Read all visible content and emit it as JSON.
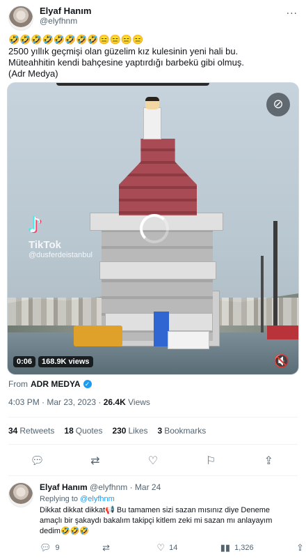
{
  "tweet": {
    "display_name": "Elyaf Hanım",
    "handle": "@elyfhnm",
    "more_icon": "more-icon",
    "emoji_line": "🤣🤣🤣🤣🤣🤣🤣🤣😑😑😑😑",
    "text_line_1": "2500 yıllık geçmişi olan güzelim kız kulesinin yeni hali bu.",
    "text_line_2": "Müteahhitin kendi bahçesine yaptırdığı barbekü gibi olmuş.",
    "text_line_3": "(Adr Medya)"
  },
  "media": {
    "watermark_app": "TikTok",
    "watermark_user": "@dusferdeistanbul",
    "elapsed": "0:06",
    "views": "168.9K views",
    "corner_icon": "media-menu-icon",
    "sound_icon": "mute-icon"
  },
  "source": {
    "prefix": "From",
    "account": "ADR MEDYA"
  },
  "meta": {
    "time": "4:03 PM · Mar 23, 2023 ·",
    "views_count": "26.4K",
    "views_label": "Views"
  },
  "stats": {
    "retweets_count": "34",
    "retweets_label": "Retweets",
    "quotes_count": "18",
    "quotes_label": "Quotes",
    "likes_count": "230",
    "likes_label": "Likes",
    "bookmarks_count": "3",
    "bookmarks_label": "Bookmarks"
  },
  "actions": [
    "reply-icon",
    "retweet-icon",
    "like-icon",
    "bookmark-icon",
    "share-icon"
  ],
  "reply": {
    "display_name": "Elyaf Hanım",
    "handle_date": "@elyfhnm · Mar 24",
    "replying_prefix": "Replying to",
    "replying_to": "@elyfhnm",
    "text": "Dikkat dikkat dikkat📢 Bu tamamen sizi sazan mısınız diye Deneme amaçlı bir şakaydı bakalım takipçi kitlem zeki mi sazan mı anlayayım dedim🤣🤣🤣",
    "reply_count": "9",
    "retweet_count": "",
    "like_count": "14",
    "views_count": "1,326"
  },
  "colors": {
    "accent": "#1d9bf0",
    "text": "#0f1419",
    "muted": "#536471",
    "divider": "#eff3f4"
  }
}
